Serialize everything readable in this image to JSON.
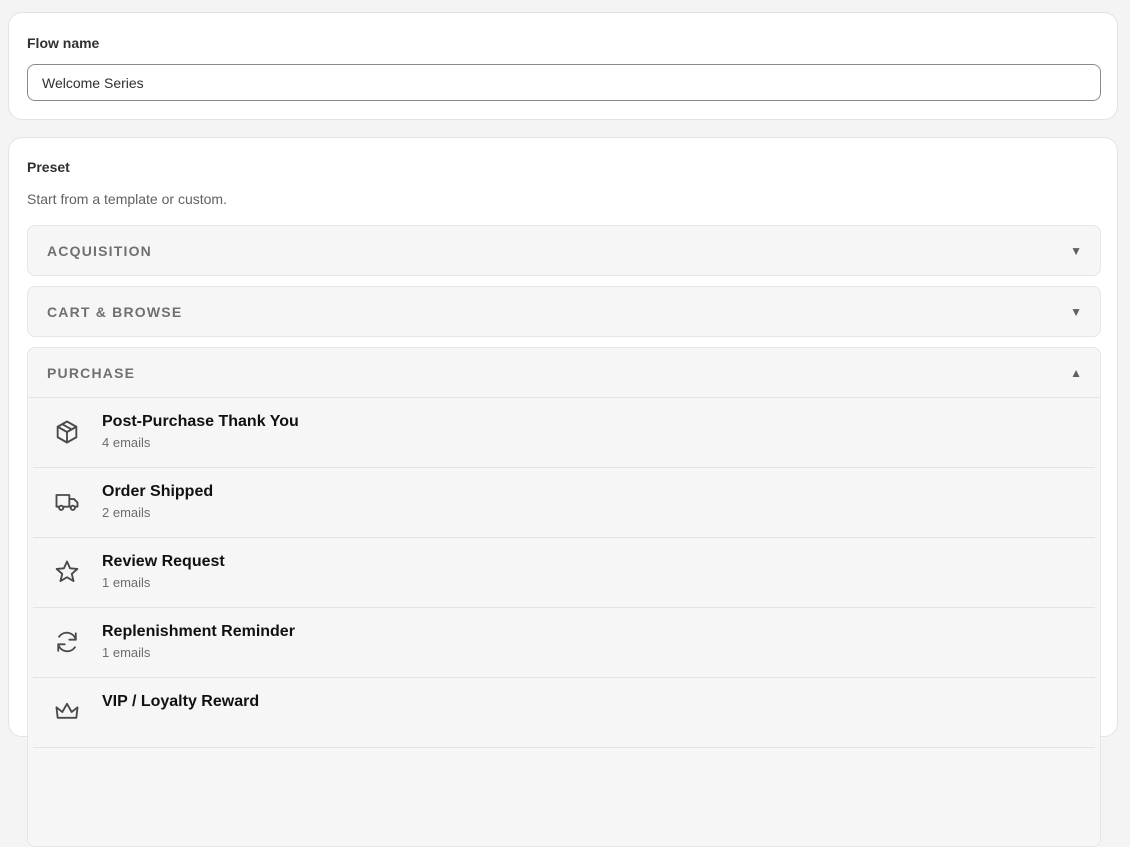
{
  "flow": {
    "label": "Flow name",
    "value": "Welcome Series"
  },
  "preset": {
    "label": "Preset",
    "helper": "Start from a template or custom.",
    "groups": [
      {
        "title": "ACQUISITION",
        "chevron": "▼",
        "expanded": false
      },
      {
        "title": "CART & BROWSE",
        "chevron": "▼",
        "expanded": false
      },
      {
        "title": "PURCHASE",
        "chevron": "▲",
        "expanded": true,
        "items": [
          {
            "title": "Post-Purchase Thank You",
            "count": "4 emails",
            "icon": "package-icon"
          },
          {
            "title": "Order Shipped",
            "count": "2 emails",
            "icon": "truck-icon"
          },
          {
            "title": "Review Request",
            "count": "1 emails",
            "icon": "star-icon"
          },
          {
            "title": "Replenishment Reminder",
            "count": "1 emails",
            "icon": "refresh-icon"
          },
          {
            "title": "VIP / Loyalty Reward",
            "count": "",
            "icon": "crown-icon"
          }
        ]
      }
    ]
  }
}
